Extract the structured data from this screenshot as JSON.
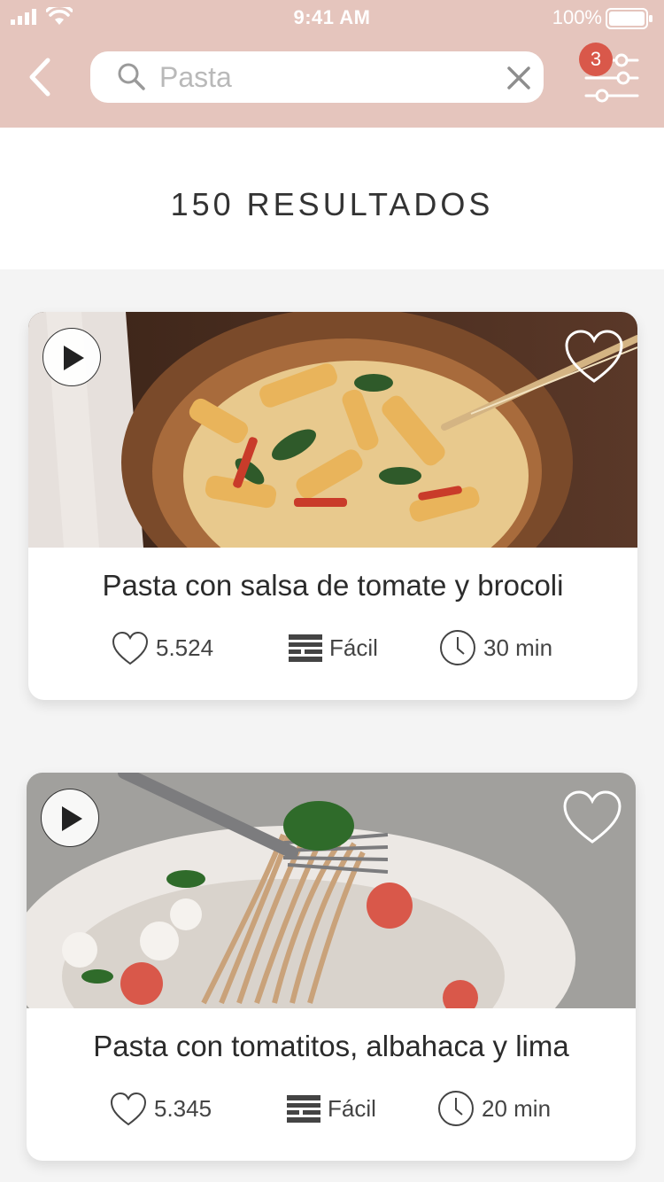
{
  "status_bar": {
    "time": "9:41 AM",
    "battery": "100%"
  },
  "search": {
    "value": "",
    "placeholder": "Pasta"
  },
  "filter": {
    "badge_count": "3"
  },
  "results": {
    "title": "150 RESULTADOS"
  },
  "recipes": [
    {
      "title": "Pasta con salsa de tomate y brocoli",
      "likes": "5.524",
      "difficulty": "Fácil",
      "time": "30 min"
    },
    {
      "title": "Pasta con tomatitos, albahaca y lima",
      "likes": "5.345",
      "difficulty": "Fácil",
      "time": "20 min"
    }
  ],
  "colors": {
    "header_bg": "#e5c5bd",
    "badge": "#d9584a",
    "page_bg": "#f4f4f4"
  },
  "icons": [
    "signal-icon",
    "wifi-icon",
    "battery-icon",
    "back-icon",
    "search-icon",
    "clear-icon",
    "filter-icon",
    "play-icon",
    "heart-icon",
    "difficulty-icon",
    "clock-icon"
  ]
}
